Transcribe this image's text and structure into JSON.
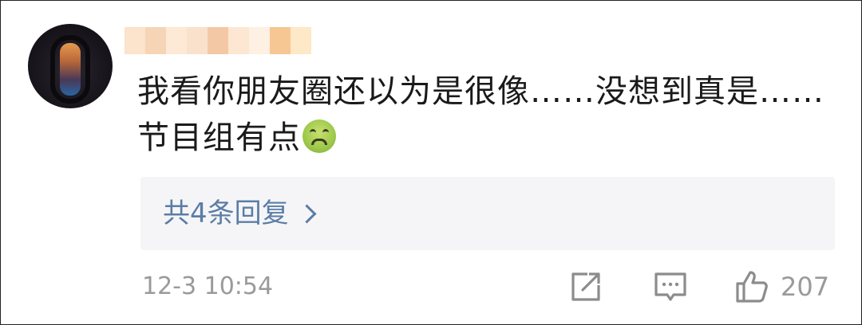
{
  "comment": {
    "username_blur_colors": [
      "#fbe3cc",
      "#f6d4b6",
      "#fde9d6",
      "#f9e1cc",
      "#f3c8a4",
      "#fde7d2",
      "#fef0e2",
      "#f6c792",
      "#fde8c8"
    ],
    "text": "我看你朋友圈还以为是很像……没想到真是……节目组有点",
    "emoji": "sick-face-emoji",
    "replies_label": "共4条回复",
    "timestamp": "12-3 10:54",
    "like_count": "207"
  },
  "icons": {
    "repost": "share-icon",
    "comment": "comment-icon",
    "like": "thumbs-up-icon",
    "chevron": "chevron-right-icon"
  },
  "colors": {
    "link": "#5b7da6",
    "meta": "#9a9a9a",
    "reply_bg": "#f5f5f7",
    "text": "#1a1a1a"
  }
}
